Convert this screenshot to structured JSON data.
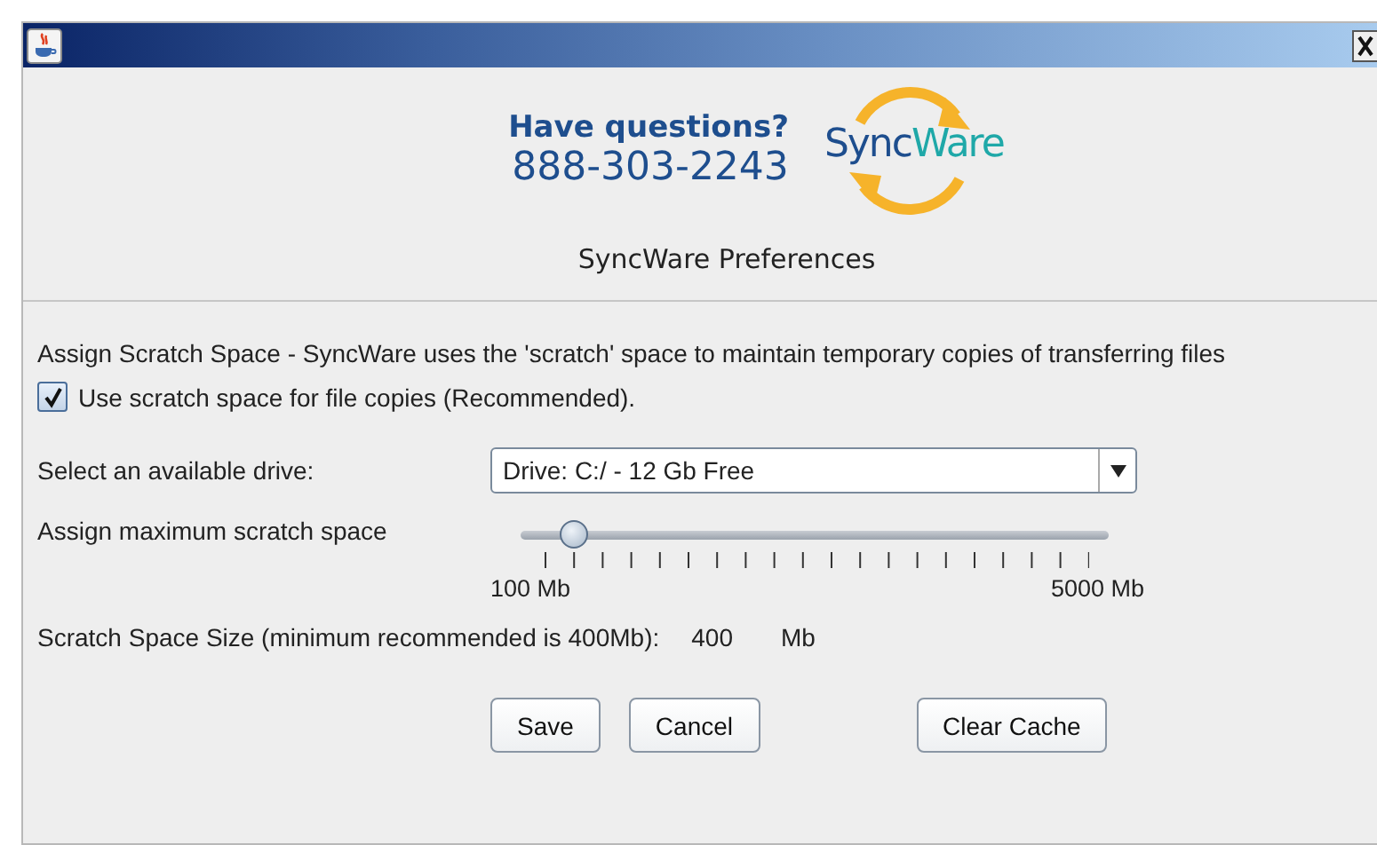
{
  "header": {
    "question": "Have questions?",
    "phone": "888-303-2243",
    "logo": {
      "part_1": "Sync",
      "part_2": "Ware"
    },
    "title": "SyncWare Preferences"
  },
  "description": "Assign Scratch Space - SyncWare uses the 'scratch' space to maintain temporary copies of transferring files",
  "use_scratch": {
    "label": "Use scratch space for file copies (Recommended).",
    "checked": true
  },
  "drive": {
    "label": "Select an available drive:",
    "value": "Drive: C:/ - 12 Gb Free"
  },
  "slider": {
    "label": "Assign maximum scratch space",
    "level": 0.07,
    "min_label": "100 Mb",
    "max_label": "5000 Mb"
  },
  "size": {
    "label": "Scratch Space Size (minimum recommended is 400Mb):",
    "value": "400",
    "unit": "Mb"
  },
  "buttons": [
    {
      "label": "Save",
      "kind": "left"
    },
    {
      "label": "Cancel",
      "kind": "left"
    },
    {
      "label": "Clear Cache",
      "kind": "right"
    }
  ]
}
